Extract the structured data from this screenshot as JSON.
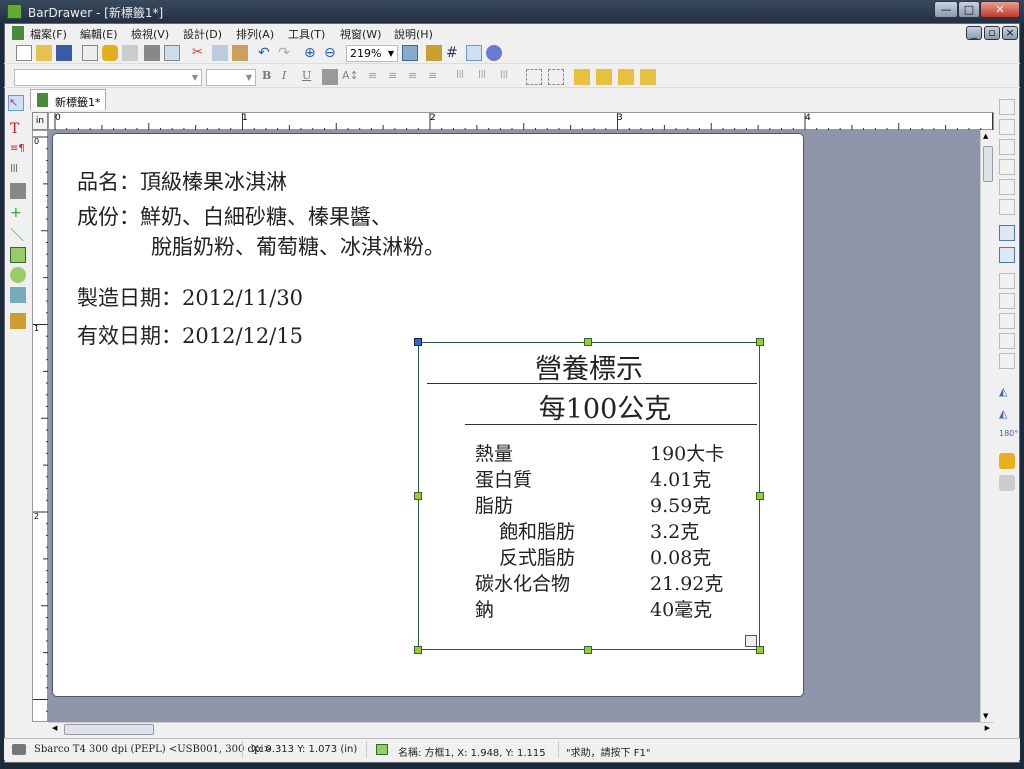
{
  "window": {
    "app": "BarDrawer",
    "title": "BarDrawer - [新標籤1*]",
    "min": "—",
    "max": "□",
    "close": "✕"
  },
  "menu": [
    "檔案(F)",
    "編輯(E)",
    "檢視(V)",
    "設計(D)",
    "排列(A)",
    "工具(T)",
    "視窗(W)",
    "說明(H)"
  ],
  "toolbar": {
    "zoom": "219%",
    "bold": "B",
    "italic": "I",
    "underline": "U"
  },
  "tab": {
    "label": "新標籤1*"
  },
  "ruler": {
    "unit": "in",
    "marks": [
      "0",
      "1",
      "2",
      "3",
      "4"
    ],
    "vmarks": [
      "0",
      "1",
      "2"
    ]
  },
  "label": {
    "name_line": "品名：頂級榛果冰淇淋",
    "ingredients_line1": "成份：鮮奶、白細砂糖、榛果醬、",
    "ingredients_line2": "脫脂奶粉、葡萄糖、冰淇淋粉。",
    "mfg_date": "製造日期：2012/11/30",
    "exp_date": "有效日期：2012/12/15"
  },
  "nutrition": {
    "title": "營養標示",
    "per": "每100公克",
    "rows": [
      {
        "name": "熱量",
        "value": "190大卡"
      },
      {
        "name": "蛋白質",
        "value": "4.01克"
      },
      {
        "name": "脂肪",
        "value": "9.59克"
      },
      {
        "name": "飽和脂肪",
        "value": "3.2克"
      },
      {
        "name": "反式脂肪",
        "value": "0.08克"
      },
      {
        "name": "碳水化合物",
        "value": "21.92克"
      },
      {
        "name": "鈉",
        "value": "40毫克"
      }
    ]
  },
  "status": {
    "printer": "Sbarco T4 300 dpi (PEPL) <USB001, 300 dpi>",
    "cursor": "X: 0.313  Y: 1.073 (in)",
    "object": "名稱: 方框1, X: 1.948, Y: 1.115",
    "help": "\"求助，請按下 F1\""
  }
}
